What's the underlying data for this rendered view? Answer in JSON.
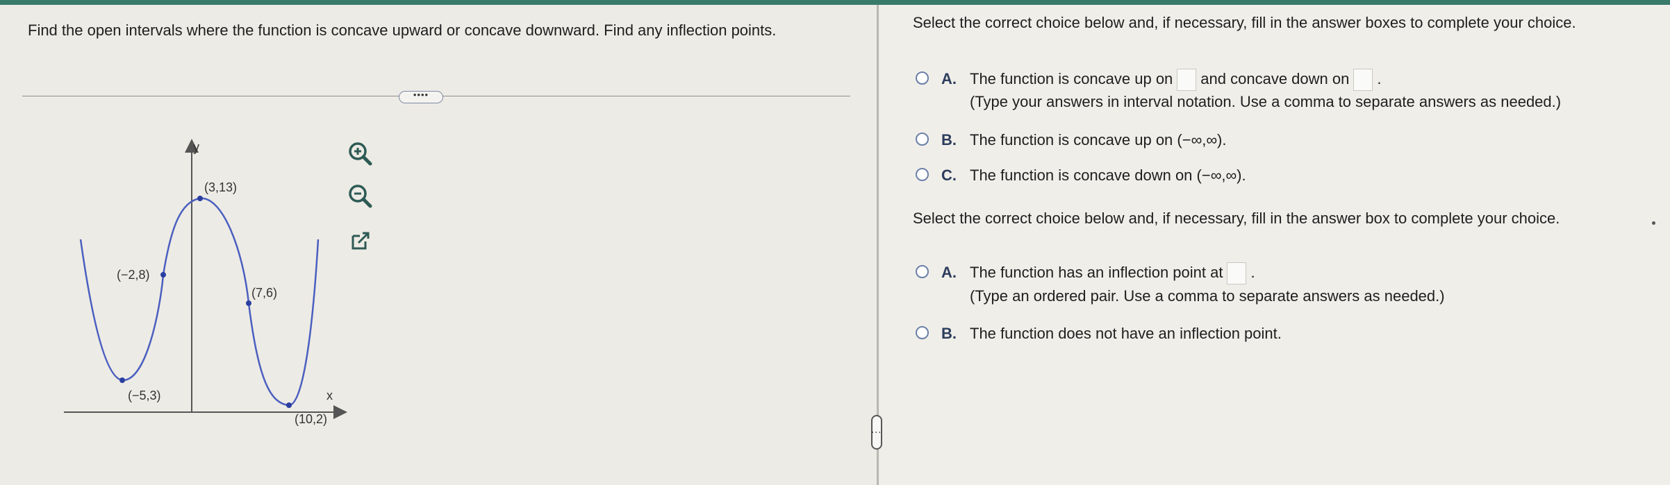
{
  "question": "Find the open intervals where the function is concave upward or concave downward. Find any inflection points.",
  "more_button": "••••",
  "graph": {
    "axis_y": "y",
    "axis_x": "x",
    "points": [
      {
        "label": "(−2,8)",
        "x": -2,
        "y": 8
      },
      {
        "label": "(3,13)",
        "x": 3,
        "y": 13
      },
      {
        "label": "(7,6)",
        "x": 7,
        "y": 6
      },
      {
        "label": "(−5,3)",
        "x": -5,
        "y": 3
      },
      {
        "label": "(10,2)",
        "x": 10,
        "y": 2
      }
    ],
    "curve_color": "#4a5fc0",
    "point_color": "#2b3fa0"
  },
  "tools": {
    "zoom_in": "zoom-in-icon",
    "zoom_out": "zoom-out-icon",
    "open_new": "external-link-icon"
  },
  "section1": {
    "prompt": "Select the correct choice below and, if necessary, fill in the answer boxes to complete your choice.",
    "choices": [
      {
        "letter": "A.",
        "text_before": "The function is concave up on",
        "text_middle": "and concave down on",
        "text_after": ".",
        "hint": "(Type your answers in interval notation. Use a comma to separate answers as needed.)"
      },
      {
        "letter": "B.",
        "text": "The function is concave up on (−∞,∞)."
      },
      {
        "letter": "C.",
        "text": "The function is concave down on (−∞,∞)."
      }
    ]
  },
  "section2": {
    "prompt": "Select the correct choice below and, if necessary, fill in the answer box to complete your choice.",
    "choices": [
      {
        "letter": "A.",
        "text_before": "The function has an inflection point at",
        "text_after": ".",
        "hint": "(Type an ordered pair. Use a comma to separate answers as needed.)"
      },
      {
        "letter": "B.",
        "text": "The function does not have an inflection point."
      }
    ]
  }
}
